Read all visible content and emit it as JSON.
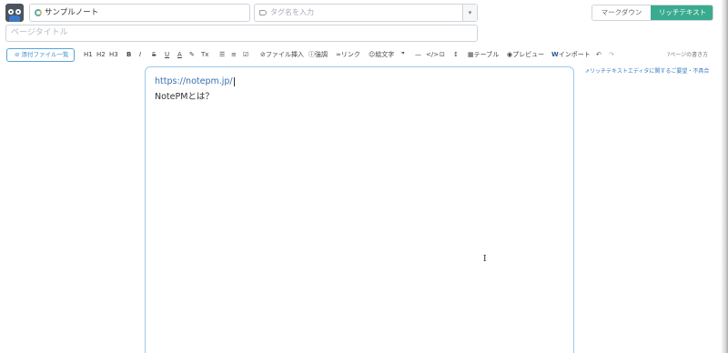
{
  "header": {
    "note_name": "サンプルノート",
    "tag_placeholder": "タグ名を入力",
    "mode_markdown": "マークダウン",
    "mode_richtext": "リッチテキスト"
  },
  "page_title_placeholder": "ページタイトル",
  "toolbar": {
    "attach_label": "添付ファイル一覧",
    "items": [
      "H1",
      "H2",
      "H3",
      "B",
      "I",
      "S",
      "U",
      "A",
      "✎",
      "Tx",
      "☰",
      "≡",
      "☑",
      "ファイル挿入",
      "強調",
      "リンク",
      "絵文字",
      "❞",
      "—",
      "</>",
      "⊡",
      "↕",
      "テーブル",
      "プレビュー",
      "インポート",
      "↶",
      "↷"
    ],
    "help_label": "ページの書き方"
  },
  "feedback_link": "リッチテキストエディタに関するご要望・不具合",
  "editor": {
    "line1": "https://notepm.jp/",
    "line2": "NotePMとは？"
  },
  "colors": {
    "accent": "#3aab8f",
    "link": "#3b7bbf",
    "editor_border": "#9ec9e8"
  }
}
